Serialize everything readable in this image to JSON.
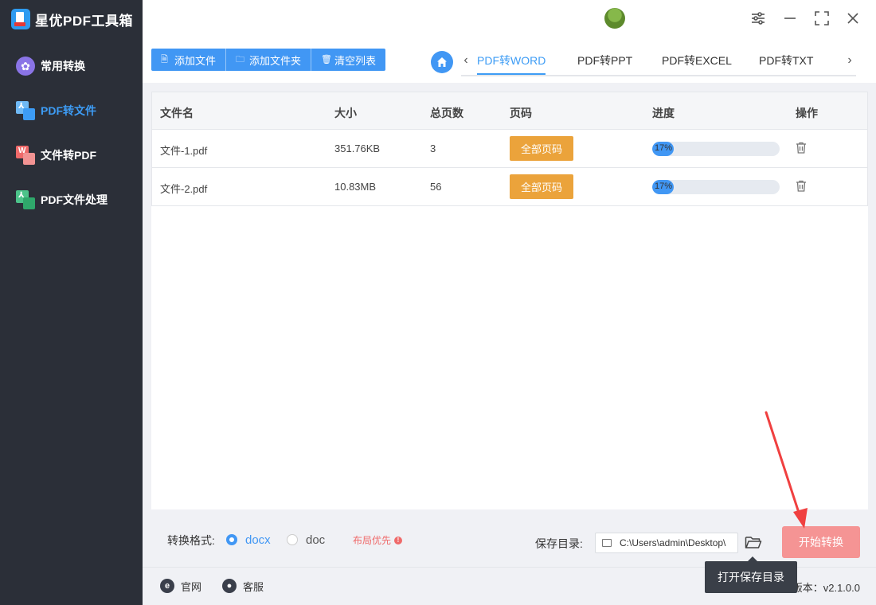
{
  "app": {
    "title": "星优PDF工具箱"
  },
  "sidebar": {
    "items": [
      {
        "label": "常用转换",
        "active": false
      },
      {
        "label": "PDF转文件",
        "active": true
      },
      {
        "label": "文件转PDF",
        "active": false
      },
      {
        "label": "PDF文件处理",
        "active": false
      }
    ]
  },
  "toolbar": {
    "add_file": "添加文件",
    "add_folder": "添加文件夹",
    "clear_list": "清空列表"
  },
  "tabs": [
    {
      "label": "PDF转WORD",
      "active": true
    },
    {
      "label": "PDF转PPT",
      "active": false
    },
    {
      "label": "PDF转EXCEL",
      "active": false
    },
    {
      "label": "PDF转TXT",
      "active": false
    }
  ],
  "table": {
    "headers": [
      "文件名",
      "大小",
      "总页数",
      "页码",
      "进度",
      "操作"
    ],
    "rows": [
      {
        "name": "文件-1.pdf",
        "size": "351.76KB",
        "pages": "3",
        "page_btn": "全部页码",
        "progress_text": "17%",
        "progress": 0.17
      },
      {
        "name": "文件-2.pdf",
        "size": "10.83MB",
        "pages": "56",
        "page_btn": "全部页码",
        "progress_text": "17%",
        "progress": 0.17
      }
    ]
  },
  "bottom": {
    "format_label": "转换格式:",
    "formats": [
      {
        "label": "docx",
        "selected": true
      },
      {
        "label": "doc",
        "selected": false
      }
    ],
    "layout_priority": "布局优先",
    "save_label": "保存目录:",
    "save_path": "C:\\Users\\admin\\Desktop\\",
    "start_button": "开始转换"
  },
  "tooltip": {
    "text": "打开保存目录"
  },
  "footer": {
    "website": "官网",
    "support": "客服",
    "version": "版本：v2.1.0.0"
  },
  "colors": {
    "accent": "#4197f4",
    "sidebar_bg": "#2b2f38",
    "orange": "#eba33b",
    "start_button": "#f59494",
    "annotation_arrow": "#f04040"
  }
}
